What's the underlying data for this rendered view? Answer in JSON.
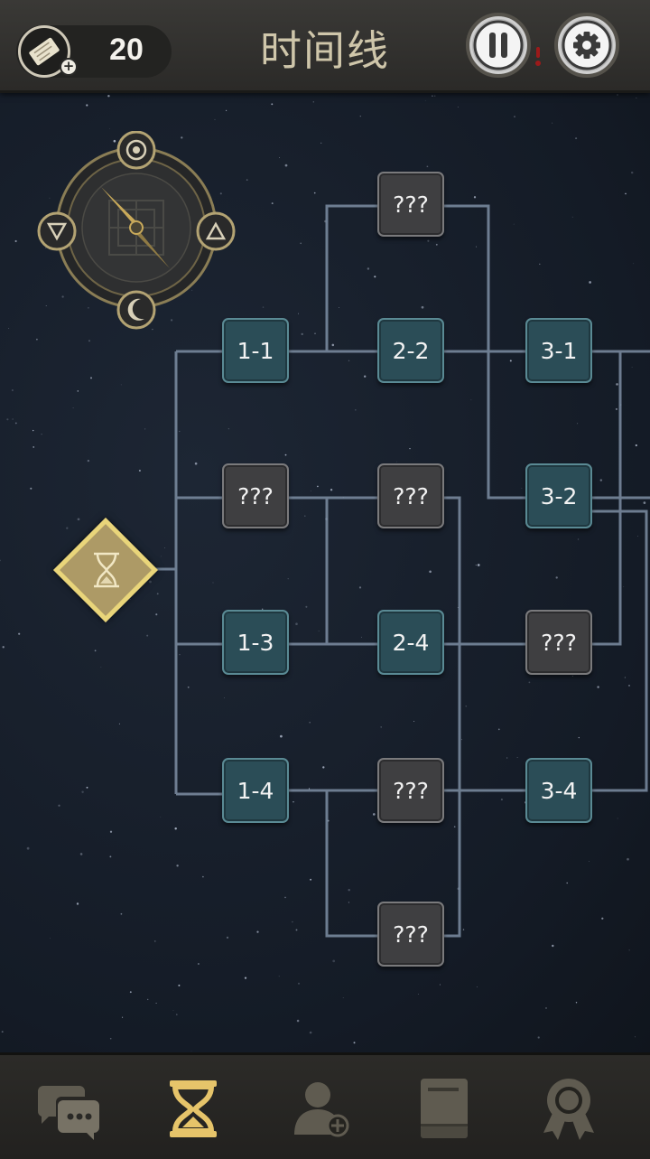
{
  "header": {
    "title": "时间线",
    "ticket_count": "20"
  },
  "timeline": {
    "start_icon": "hourglass-icon",
    "nodes": [
      {
        "id": "1-1",
        "label": "1-1",
        "state": "unlocked"
      },
      {
        "id": "1-2",
        "label": "???",
        "state": "locked"
      },
      {
        "id": "1-3",
        "label": "1-3",
        "state": "unlocked"
      },
      {
        "id": "1-4",
        "label": "1-4",
        "state": "unlocked"
      },
      {
        "id": "2-1",
        "label": "???",
        "state": "locked"
      },
      {
        "id": "2-2",
        "label": "2-2",
        "state": "unlocked"
      },
      {
        "id": "2-3",
        "label": "???",
        "state": "locked"
      },
      {
        "id": "2-4",
        "label": "2-4",
        "state": "unlocked"
      },
      {
        "id": "2-5",
        "label": "???",
        "state": "locked"
      },
      {
        "id": "2-6",
        "label": "???",
        "state": "locked"
      },
      {
        "id": "3-1",
        "label": "3-1",
        "state": "unlocked"
      },
      {
        "id": "3-2",
        "label": "3-2",
        "state": "unlocked"
      },
      {
        "id": "3-3",
        "label": "???",
        "state": "locked"
      },
      {
        "id": "3-4",
        "label": "3-4",
        "state": "unlocked"
      }
    ]
  },
  "bottom_nav": [
    {
      "name": "chat",
      "icon": "chat-bubbles-icon",
      "active": false
    },
    {
      "name": "timeline",
      "icon": "hourglass-icon",
      "active": true
    },
    {
      "name": "characters",
      "icon": "add-person-icon",
      "active": false
    },
    {
      "name": "journal",
      "icon": "book-icon",
      "active": false
    },
    {
      "name": "achievements",
      "icon": "medal-icon",
      "active": false
    }
  ],
  "colors": {
    "accent_gold": "#e9d57a",
    "node_unlocked": "#2b4d57",
    "node_locked": "#3f3f41",
    "line": "#7d8ea3",
    "nav_inactive": "#6e6a5d"
  }
}
